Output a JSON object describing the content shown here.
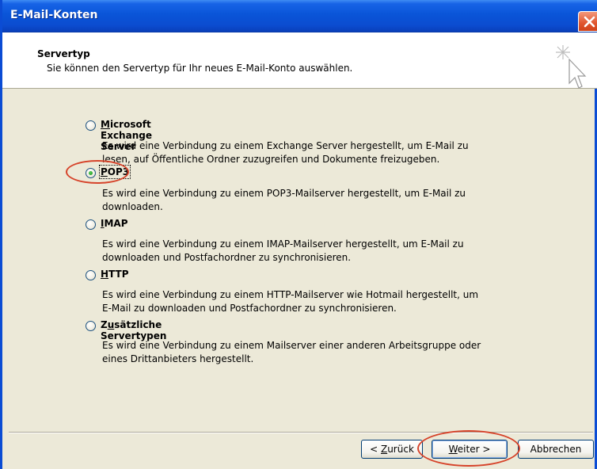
{
  "window": {
    "title": "E-Mail-Konten"
  },
  "header": {
    "title": "Servertyp",
    "subtitle": "Sie können den Servertyp für Ihr neues E-Mail-Konto auswählen."
  },
  "options": [
    {
      "access_key": "M",
      "label_rest": "icrosoft Exchange Server",
      "selected": false,
      "desc_line1": "Es wird eine Verbindung zu einem Exchange Server hergestellt, um E-Mail zu",
      "desc_line2": "lesen, auf Öffentliche Ordner zuzugreifen und Dokumente freizugeben."
    },
    {
      "access_key": "P",
      "label_rest": "OP3",
      "selected": true,
      "desc_line1": "Es wird eine Verbindung zu einem POP3-Mailserver hergestellt, um E-Mail zu",
      "desc_line2": "downloaden."
    },
    {
      "access_key": "I",
      "label_rest": "MAP",
      "selected": false,
      "desc_line1": "Es wird eine Verbindung zu einem IMAP-Mailserver hergestellt, um E-Mail zu",
      "desc_line2": "downloaden und Postfachordner zu synchronisieren."
    },
    {
      "access_key": "H",
      "label_rest": "TTP",
      "selected": false,
      "desc_line1": "Es wird eine Verbindung zu einem HTTP-Mailserver wie Hotmail hergestellt, um",
      "desc_line2": "E-Mail zu downloaden und Postfachordner zu synchronisieren."
    },
    {
      "label_pre": "Z",
      "access_key": "u",
      "label_rest": "sätzliche Servertypen",
      "selected": false,
      "desc_line1": "Es wird eine Verbindung zu einem Mailserver einer anderen Arbeitsgruppe oder",
      "desc_line2": "eines Drittanbieters hergestellt."
    }
  ],
  "buttons": {
    "back_pre": "< ",
    "back_key": "Z",
    "back_rest": "urück",
    "next_key": "W",
    "next_rest": "eiter >",
    "cancel": "Abbrechen"
  },
  "colors": {
    "titlebar": "#0b4cd4",
    "dialog_bg": "#ece9d8",
    "annotation": "#d6432a",
    "radio_dot": "#2b9b2b"
  }
}
